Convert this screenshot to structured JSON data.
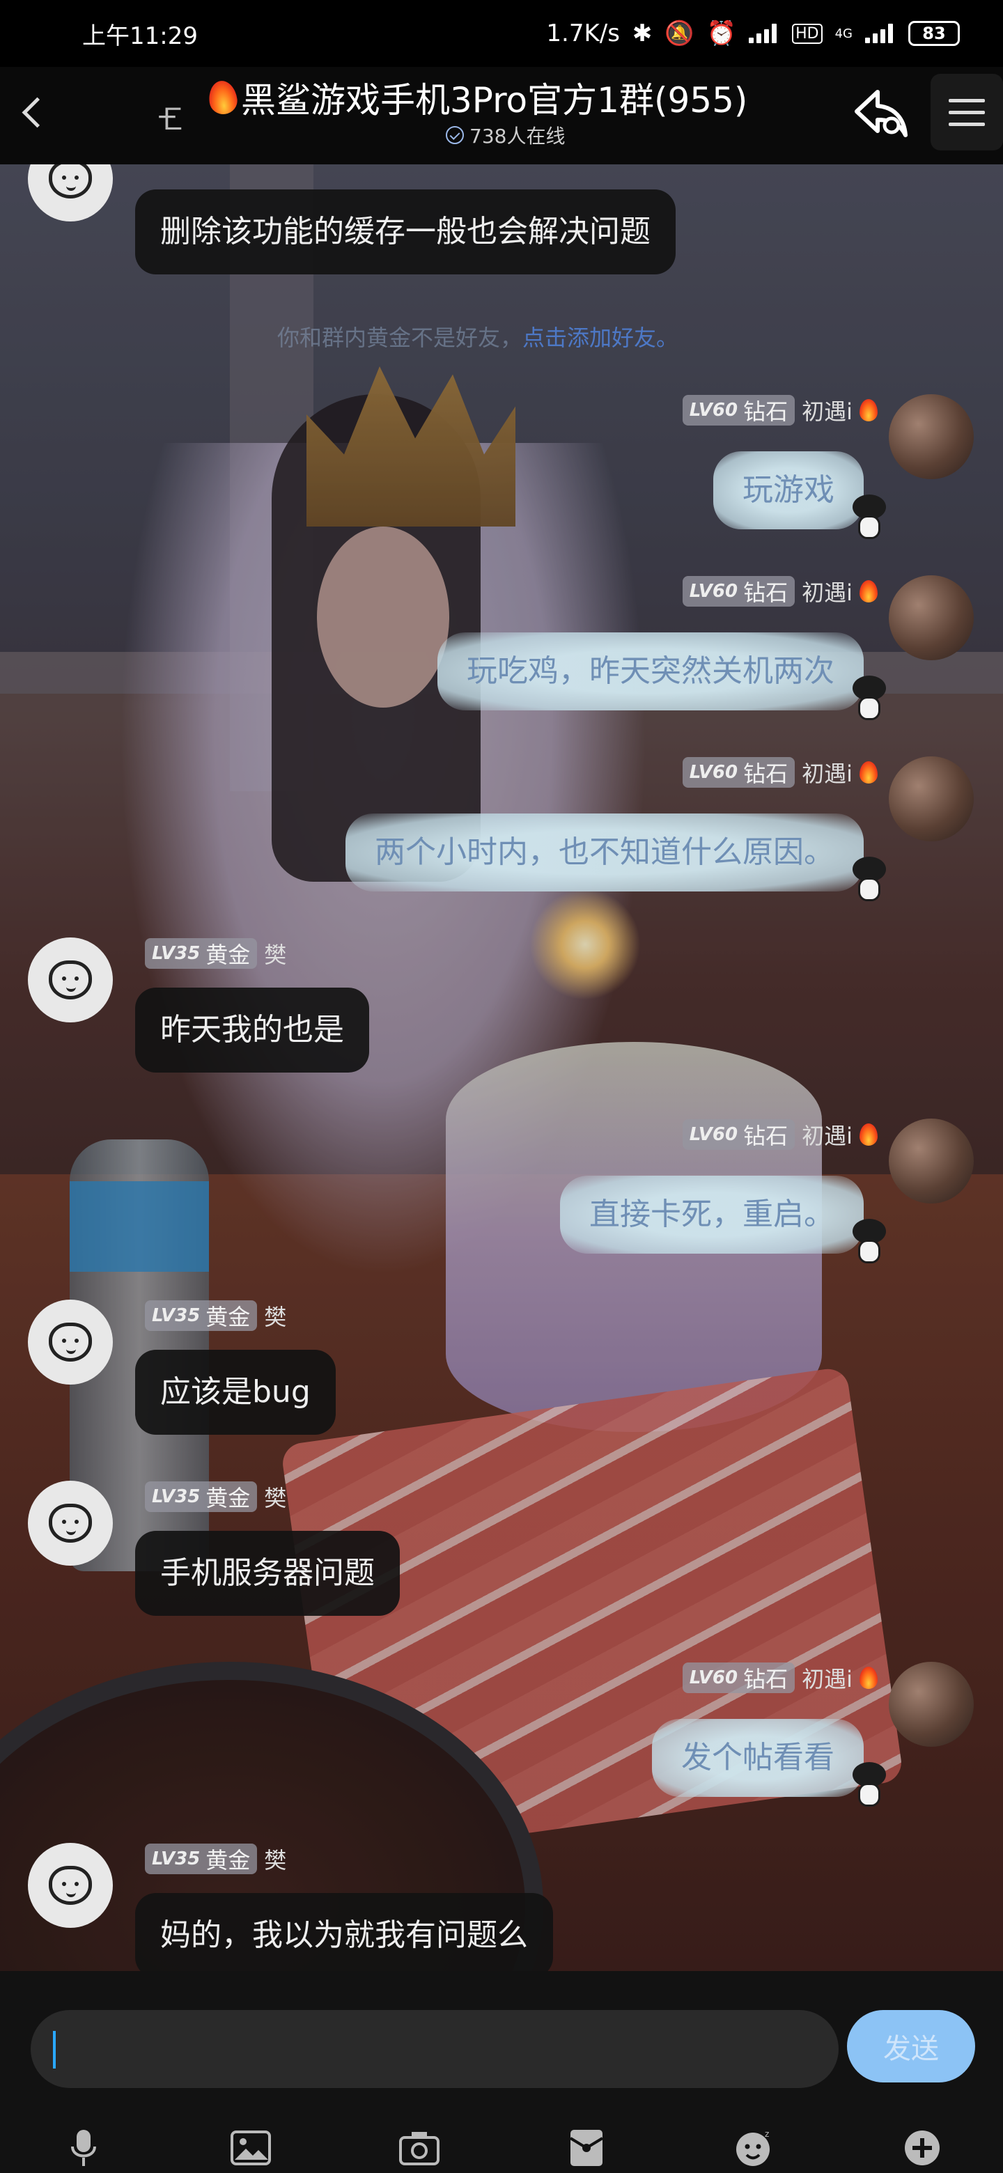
{
  "status_bar": {
    "time": "上午11:29",
    "net_speed": "1.7K/s",
    "network": "4G",
    "hd": "HD",
    "battery": "83"
  },
  "header": {
    "title": "黑鲨游戏手机3Pro官方1群(955)",
    "online": "738人在线"
  },
  "system_tip": {
    "text": "你和群内黄金不是好友，",
    "link": "点击添加好友。"
  },
  "messages": [
    {
      "side": "other",
      "text": "删除该功能的缓存一般也会解决问题"
    },
    {
      "side": "mine",
      "level": "LV60",
      "rank": "钻石",
      "name": "初遇i",
      "text": "玩游戏"
    },
    {
      "side": "mine",
      "level": "LV60",
      "rank": "钻石",
      "name": "初遇i",
      "text": "玩吃鸡，昨天突然关机两次"
    },
    {
      "side": "mine",
      "level": "LV60",
      "rank": "钻石",
      "name": "初遇i",
      "text": "两个小时内，也不知道什么原因。"
    },
    {
      "side": "other",
      "level": "LV35",
      "rank": "黄金",
      "name": "樊",
      "text": "昨天我的也是"
    },
    {
      "side": "mine",
      "level": "LV60",
      "rank": "钻石",
      "name": "初遇i",
      "text": "直接卡死，重启。"
    },
    {
      "side": "other",
      "level": "LV35",
      "rank": "黄金",
      "name": "樊",
      "text": "应该是bug"
    },
    {
      "side": "other",
      "level": "LV35",
      "rank": "黄金",
      "name": "樊",
      "text": "手机服务器问题"
    },
    {
      "side": "mine",
      "level": "LV60",
      "rank": "钻石",
      "name": "初遇i",
      "text": "发个帖看看"
    },
    {
      "side": "other",
      "level": "LV35",
      "rank": "黄金",
      "name": "樊",
      "text": "妈的，我以为就我有问题么"
    }
  ],
  "input": {
    "placeholder": "",
    "send_label": "发送"
  },
  "toolbar_icons": [
    "microphone-icon",
    "image-icon",
    "camera-icon",
    "red-packet-icon",
    "emoji-icon",
    "plus-icon"
  ],
  "colors": {
    "accent": "#8cc3f5",
    "caret": "#2aa8ff",
    "mine_bubble": "#cee4ec",
    "mine_text": "#6f8fb5",
    "other_bubble": "#121212"
  }
}
